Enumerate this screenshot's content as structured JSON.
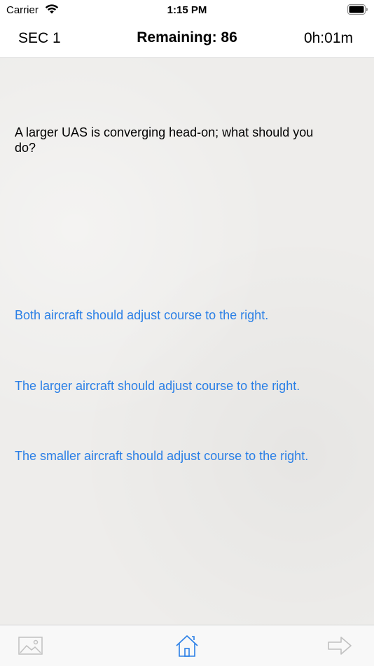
{
  "status_bar": {
    "carrier": "Carrier",
    "time": "1:15 PM"
  },
  "header": {
    "section": "SEC 1",
    "remaining": "Remaining: 86",
    "timer": "0h:01m"
  },
  "question": {
    "text": "A larger UAS is converging head-on; what should you do?"
  },
  "answers": [
    "Both aircraft should adjust course to the right.",
    "The larger aircraft should adjust course to the right.",
    "The smaller aircraft should adjust course to the right."
  ],
  "toolbar": {
    "buttons": [
      "image-icon",
      "home-icon",
      "next-arrow-icon"
    ]
  },
  "colors": {
    "answer": "#2a7fe6",
    "content_bg": "#eeedeb",
    "home_icon": "#2a7fe6",
    "disabled_icon": "#c0c0c0"
  }
}
